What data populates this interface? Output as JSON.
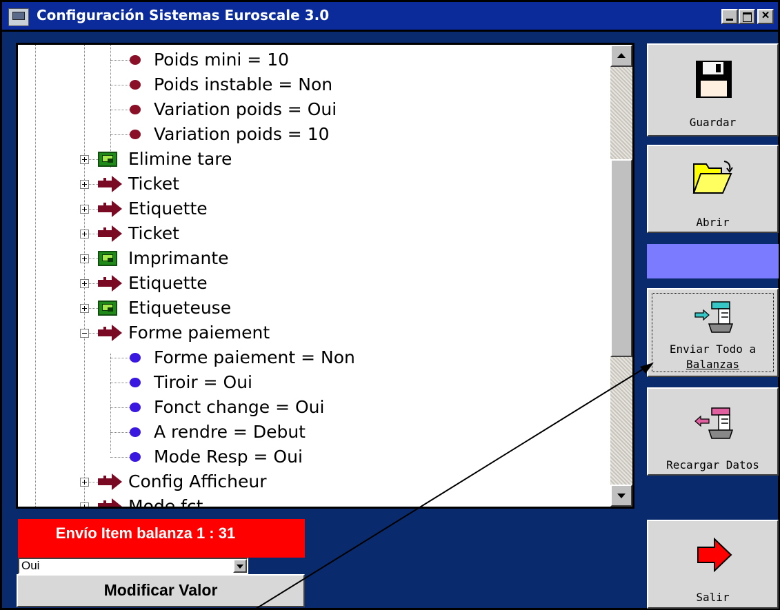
{
  "window": {
    "title": "Configuración Sistemas Euroscale 3.0"
  },
  "tree": {
    "items": [
      {
        "label": "Poids mini = 10",
        "icon": "red-dot-icon",
        "level": 2
      },
      {
        "label": "Poids instable = Non",
        "icon": "red-dot-icon",
        "level": 2
      },
      {
        "label": "Variation poids = Oui",
        "icon": "red-dot-icon",
        "level": 2
      },
      {
        "label": "Variation poids = 10",
        "icon": "red-dot-icon",
        "level": 2
      },
      {
        "label": "Elimine tare",
        "icon": "green-device-icon",
        "level": 1,
        "expander": "plus"
      },
      {
        "label": "Ticket",
        "icon": "arrow-right-icon",
        "level": 1,
        "expander": "plus"
      },
      {
        "label": "Etiquette",
        "icon": "arrow-right-icon",
        "level": 1,
        "expander": "plus"
      },
      {
        "label": "Ticket",
        "icon": "arrow-right-icon",
        "level": 1,
        "expander": "plus"
      },
      {
        "label": "Imprimante",
        "icon": "green-device-icon",
        "level": 1,
        "expander": "plus"
      },
      {
        "label": "Etiquette",
        "icon": "arrow-right-icon",
        "level": 1,
        "expander": "plus"
      },
      {
        "label": "Etiqueteuse",
        "icon": "green-device-icon",
        "level": 1,
        "expander": "plus"
      },
      {
        "label": "Forme paiement",
        "icon": "arrow-right-icon",
        "level": 1,
        "expander": "minus"
      },
      {
        "label": "Forme paiement = Non",
        "icon": "blue-dot-icon",
        "level": 2
      },
      {
        "label": "Tiroir = Oui",
        "icon": "blue-dot-icon",
        "level": 2
      },
      {
        "label": "Fonct  change  = Oui",
        "icon": "blue-dot-icon",
        "level": 2
      },
      {
        "label": "A rendre = Debut",
        "icon": "blue-dot-icon",
        "level": 2
      },
      {
        "label": "Mode Resp  = Oui",
        "icon": "blue-dot-icon",
        "level": 2
      },
      {
        "label": "Config  Afficheur",
        "icon": "arrow-right-icon",
        "level": 1,
        "expander": "plus"
      },
      {
        "label": "Mode fct",
        "icon": "arrow-right-icon",
        "level": 1,
        "expander": "plus"
      }
    ]
  },
  "status": {
    "text": "Envío Item balanza 1 : 31"
  },
  "value_select": {
    "selected": "Oui"
  },
  "buttons": {
    "modify": "Modificar Valor",
    "save": "Guardar",
    "open": "Abrir",
    "send_all_line1": "Enviar Todo a",
    "send_all_line2": "Balanzas",
    "reload": "Recargar Datos",
    "exit": "Salir"
  },
  "colors": {
    "title_bar": "#0b2b9a",
    "status_background": "#ff0000",
    "blue_panel": "#7b7bff",
    "window_background": "#0a2a6e"
  }
}
